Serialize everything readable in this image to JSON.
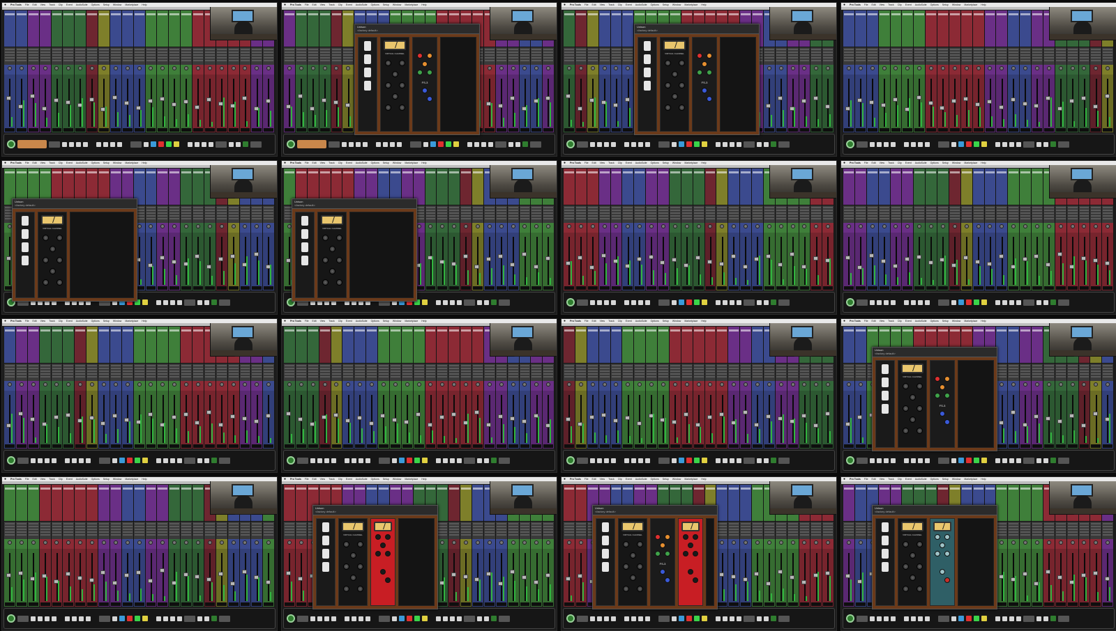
{
  "daw": {
    "menu": {
      "app_name": "Pro Tools",
      "items": [
        "File",
        "Edit",
        "View",
        "Track",
        "Clip",
        "Event",
        "AudioSuite",
        "Options",
        "Setup",
        "Window",
        "Marketplace",
        "Help"
      ]
    },
    "session_title": ""
  },
  "plugin_window": {
    "title": "Unison",
    "preset": "<factory default>",
    "channel_label": "VIRTUAL CHANNEL",
    "eq_name": "FS-3"
  },
  "strip_palette": [
    "#3b4a8e",
    "#3b4a8e",
    "#6a2f86",
    "#6a2f86",
    "#34673a",
    "#34673a",
    "#34673a",
    "#6e2630",
    "#7e7f2a",
    "#3b4a8e",
    "#3b4a8e",
    "#3b4a8e",
    "#3f7f3a",
    "#3f7f3a",
    "#3f7f3a",
    "#3f7f3a",
    "#8c2a35",
    "#8c2a35",
    "#8c2a35",
    "#8c2a35",
    "#8c2a35",
    "#6a2f86",
    "#6a2f86"
  ],
  "colors": {
    "meter_green": "#3ad44a",
    "vu_face": "#e9c66d",
    "eq_red_panel": "#c81e24",
    "eq_teal_panel": "#2f5f66",
    "plugin_wood": "#6b3a1a"
  },
  "frames": [
    {
      "id": "f1",
      "plugin": null
    },
    {
      "id": "f2",
      "plugin": {
        "layout": "channel+eq-black"
      }
    },
    {
      "id": "f3",
      "plugin": {
        "layout": "channel+eq-black"
      }
    },
    {
      "id": "f4",
      "plugin": null
    },
    {
      "id": "f5",
      "plugin": {
        "layout": "channel-only"
      }
    },
    {
      "id": "f6",
      "plugin": {
        "layout": "channel-only"
      }
    },
    {
      "id": "f7",
      "plugin": null
    },
    {
      "id": "f8",
      "plugin": null
    },
    {
      "id": "f9",
      "plugin": null
    },
    {
      "id": "f10",
      "plugin": null
    },
    {
      "id": "f11",
      "plugin": null
    },
    {
      "id": "f12",
      "plugin": {
        "layout": "channel+eq-black"
      }
    },
    {
      "id": "f13",
      "plugin": null
    },
    {
      "id": "f14",
      "plugin": {
        "layout": "channel+eq-red"
      }
    },
    {
      "id": "f15",
      "plugin": {
        "layout": "channel+eq-black+eq-red"
      }
    },
    {
      "id": "f16",
      "plugin": {
        "layout": "channel+eq-teal"
      }
    }
  ]
}
